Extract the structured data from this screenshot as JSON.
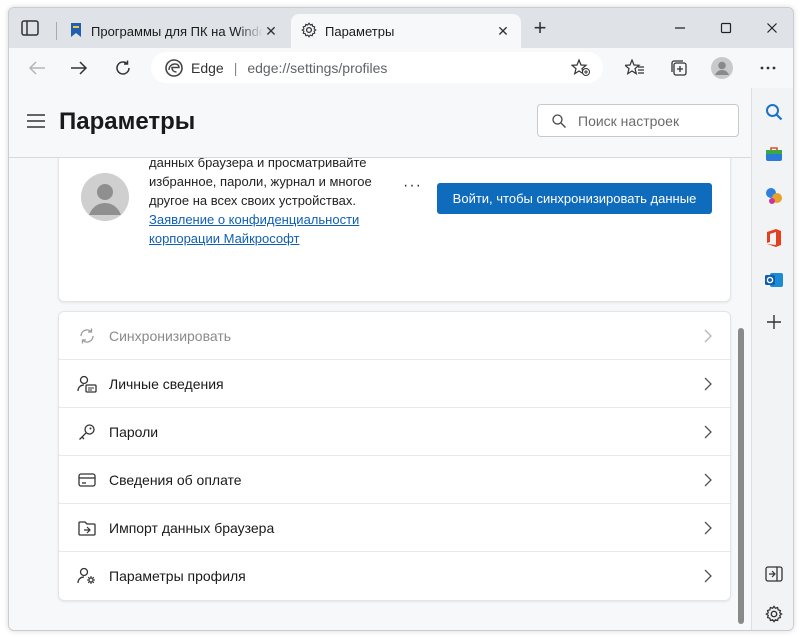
{
  "tabs": [
    {
      "title": "Программы для ПК на Windows",
      "close_glyph": "✕"
    },
    {
      "title": "Параметры",
      "close_glyph": "✕"
    }
  ],
  "new_tab_glyph": "+",
  "address_bar": {
    "site_label": "Edge",
    "separator": "|",
    "url": "edge://settings/profiles"
  },
  "header": {
    "title": "Параметры",
    "search_placeholder": "Поиск настроек"
  },
  "profile": {
    "text_before_link": "данных браузера и просматривайте избранное, пароли, журнал и многое другое на всех своих устройствах.",
    "link_text": "Заявление о конфиденциальности корпорации Майкрософт",
    "more_label": "···",
    "signin_button": "Войти, чтобы синхронизировать данные"
  },
  "settings_items": [
    {
      "label": "Синхронизировать",
      "icon": "sync-icon",
      "disabled": true
    },
    {
      "label": "Личные сведения",
      "icon": "personal-info-icon"
    },
    {
      "label": "Пароли",
      "icon": "key-icon"
    },
    {
      "label": "Сведения об оплате",
      "icon": "credit-card-icon"
    },
    {
      "label": "Импорт данных браузера",
      "icon": "import-folder-icon"
    },
    {
      "label": "Параметры профиля",
      "icon": "profile-settings-icon"
    }
  ],
  "colors": {
    "accent": "#0f6cbd",
    "link": "#0f5fb6"
  }
}
